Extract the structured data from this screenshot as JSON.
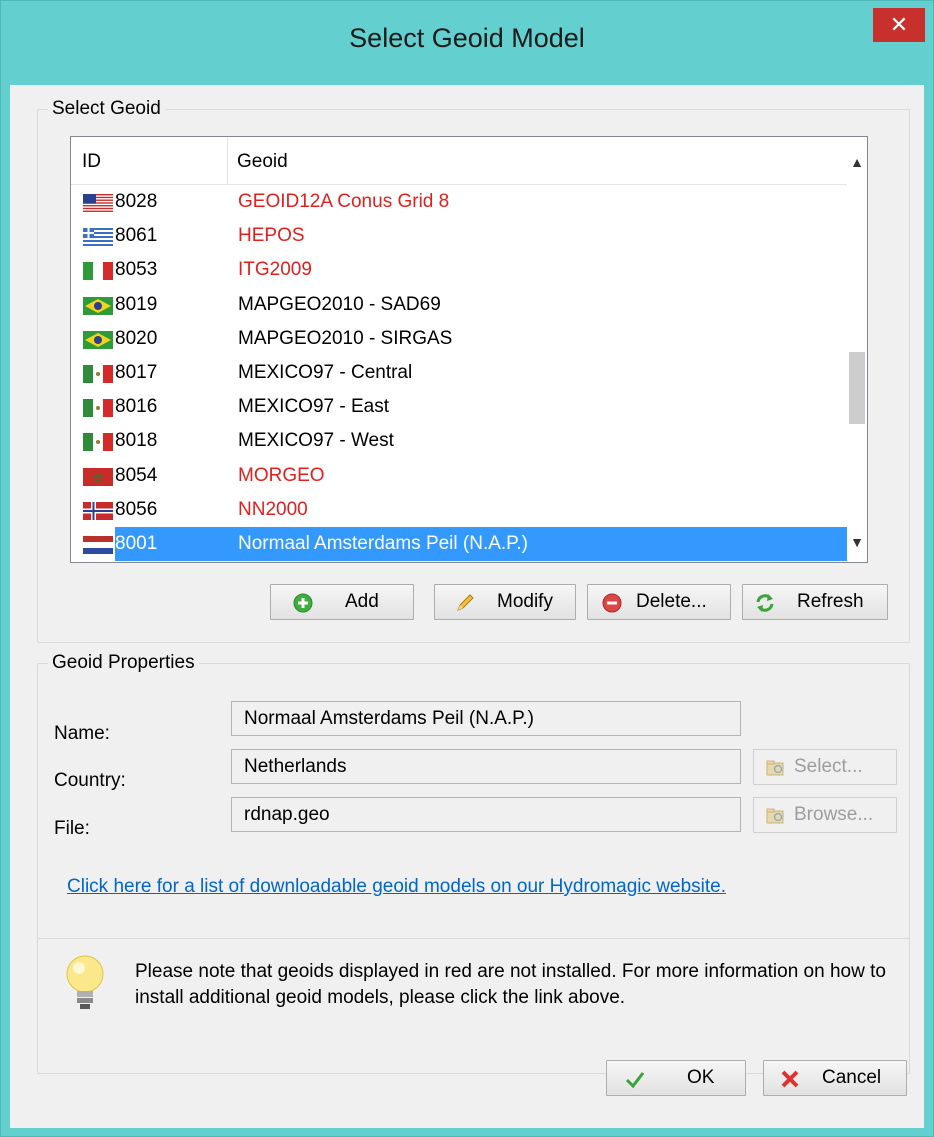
{
  "window": {
    "title": "Select Geoid Model",
    "close_glyph": "✕"
  },
  "select_geoid": {
    "legend": "Select Geoid",
    "columns": {
      "id": "ID",
      "geoid": "Geoid"
    },
    "rows": [
      {
        "flag": "us-flag-icon",
        "id": "8028",
        "name": "GEOID12A Conus Grid 8",
        "installed": false
      },
      {
        "flag": "greece-flag-icon",
        "id": "8061",
        "name": "HEPOS",
        "installed": false
      },
      {
        "flag": "italy-flag-icon",
        "id": "8053",
        "name": "ITG2009",
        "installed": false
      },
      {
        "flag": "brazil-flag-icon",
        "id": "8019",
        "name": "MAPGEO2010 - SAD69",
        "installed": true
      },
      {
        "flag": "brazil-flag-icon",
        "id": "8020",
        "name": "MAPGEO2010 - SIRGAS",
        "installed": true
      },
      {
        "flag": "mexico-flag-icon",
        "id": "8017",
        "name": "MEXICO97 - Central",
        "installed": true
      },
      {
        "flag": "mexico-flag-icon",
        "id": "8016",
        "name": "MEXICO97 - East",
        "installed": true
      },
      {
        "flag": "mexico-flag-icon",
        "id": "8018",
        "name": "MEXICO97 - West",
        "installed": true
      },
      {
        "flag": "morocco-flag-icon",
        "id": "8054",
        "name": "MORGEO",
        "installed": false
      },
      {
        "flag": "norway-flag-icon",
        "id": "8056",
        "name": "NN2000",
        "installed": false
      },
      {
        "flag": "netherlands-flag-icon",
        "id": "8001",
        "name": "Normaal Amsterdams Peil (N.A.P.)",
        "installed": true,
        "selected": true
      }
    ],
    "buttons": {
      "add": "Add",
      "modify": "Modify",
      "delete": "Delete...",
      "refresh": "Refresh"
    }
  },
  "geoid_properties": {
    "legend": "Geoid Properties",
    "name_label": "Name:",
    "name_value": "Normaal Amsterdams Peil (N.A.P.)",
    "country_label": "Country:",
    "country_value": "Netherlands",
    "file_label": "File:",
    "file_value": "rdnap.geo",
    "select_button": "Select...",
    "browse_button": "Browse...",
    "link": "Click here for a list of downloadable geoid models on our Hydromagic website."
  },
  "note": {
    "text": "Please note that geoids displayed in red are not installed. For more information on how to install additional geoid models, please click the link above."
  },
  "footer": {
    "ok": "OK",
    "cancel": "Cancel"
  },
  "colors": {
    "title_bar": "#63cfcf",
    "not_installed": "#e41e1e",
    "selection": "#3399ff",
    "close": "#c7302c"
  }
}
